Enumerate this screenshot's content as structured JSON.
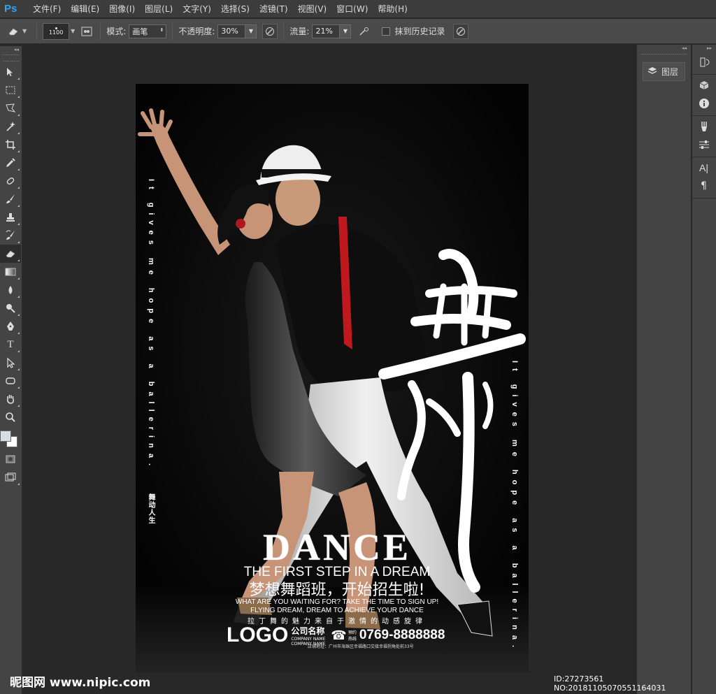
{
  "app": {
    "logo": "Ps"
  },
  "menu": [
    "文件(F)",
    "编辑(E)",
    "图像(I)",
    "图层(L)",
    "文字(Y)",
    "选择(S)",
    "滤镜(T)",
    "视图(V)",
    "窗口(W)",
    "帮助(H)"
  ],
  "options": {
    "brush_size": "1100",
    "mode_label": "模式:",
    "mode_value": "画笔",
    "opacity_label": "不透明度:",
    "opacity_value": "30%",
    "flow_label": "流量:",
    "flow_value": "21%",
    "erase_history_label": "抹到历史记录"
  },
  "panels": {
    "layers_label": "图层"
  },
  "poster": {
    "vertical_left": "It gives me hope as a ballerina.",
    "vertical_left_cn": "舞动人生",
    "vertical_right": "It gives me hope as a ballerina.",
    "calligraphy": "舞",
    "title": "DANCE",
    "subtitle": "THE FIRST STEP IN A DREAM",
    "slogan_cn": "梦想舞蹈班，开始招生啦!",
    "slogan_en_1": "WHAT ARE YOU WAITING FOR? TAKE THE TIME TO SIGN UP!",
    "slogan_en_2": "FLYING DREAM, DREAM TO ACHIEVE YOUR DANCE",
    "spaced_cn": "拉丁舞的魅力来自于激情的动感旋律",
    "logo": "LOGO",
    "company_cn": "公司名称",
    "company_en_1": "COMPANY NAME",
    "company_en_2": "COMPANY NAME",
    "hotline_1": "预约",
    "hotline_2": "热线",
    "phone": "0769-8888888",
    "address": "店铺地址：广州市海珠区幸福路口交接幸福拐角处前33号"
  },
  "watermark": {
    "site": "昵图网 www.nipic.com",
    "id": "ID:27273561 NO:20181105070551164031"
  },
  "colors": {
    "accent_red": "#c0181f",
    "ps_blue": "#2fa3f5"
  }
}
